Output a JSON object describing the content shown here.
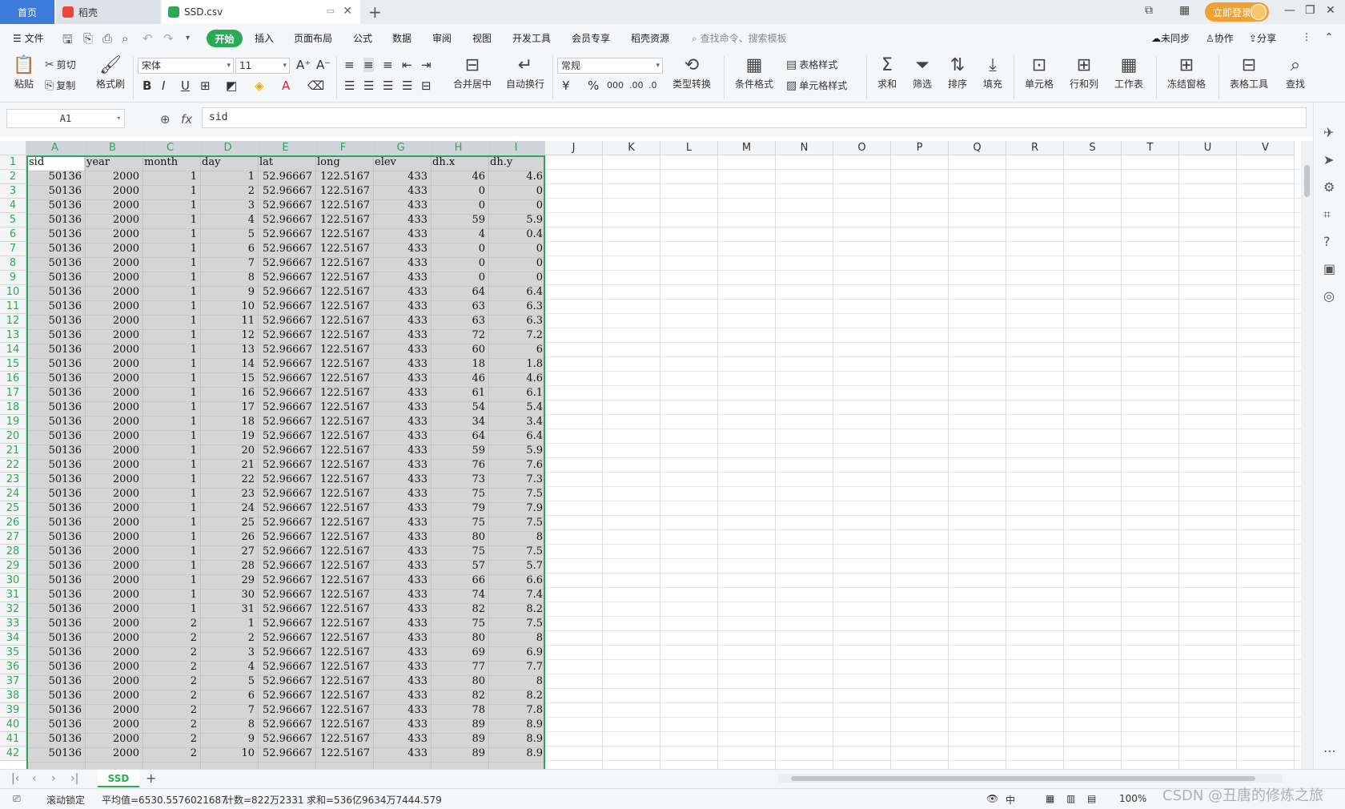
{
  "titlebar": {
    "home_tab": "首页",
    "doc_tab": "稻壳",
    "file_tab": "SSD.csv",
    "login_label": "立即登录"
  },
  "menu": {
    "file": "文件",
    "start": "开始",
    "items": [
      "插入",
      "页面布局",
      "公式",
      "数据",
      "审阅",
      "视图",
      "开发工具",
      "会员专享",
      "稻壳资源"
    ],
    "search_placeholder": "查找命令、搜索模板",
    "sync": "未同步",
    "collab": "协作",
    "share": "分享"
  },
  "ribbon": {
    "paste": "粘贴",
    "cut": "剪切",
    "copy": "复制",
    "format_painter": "格式刷",
    "font_name": "宋体",
    "font_size": "11",
    "merge_center": "合并居中",
    "wrap_text": "自动换行",
    "number_format": "常规",
    "type_convert": "类型转换",
    "conditional_format": "条件格式",
    "table_style": "表格样式",
    "cell_style": "单元格样式",
    "sum": "求和",
    "filter": "筛选",
    "sort": "排序",
    "fill": "填充",
    "cell": "单元格",
    "rows_cols": "行和列",
    "worksheet": "工作表",
    "freeze": "冻结窗格",
    "table_tools": "表格工具",
    "find": "查找"
  },
  "formula_bar": {
    "name_box": "A1",
    "fx": "fx",
    "content": "sid"
  },
  "columns": [
    "A",
    "B",
    "C",
    "D",
    "E",
    "F",
    "G",
    "H",
    "I",
    "J",
    "K",
    "L",
    "M",
    "N",
    "O",
    "P",
    "Q",
    "R",
    "S",
    "T",
    "U",
    "V"
  ],
  "header_row": [
    "sid",
    "year",
    "month",
    "day",
    "lat",
    "long",
    "elev",
    "dh.x",
    "dh.y"
  ],
  "rows": [
    [
      "50136",
      "2000",
      "1",
      "1",
      "52.96667",
      "122.5167",
      "433",
      "46",
      "4.6"
    ],
    [
      "50136",
      "2000",
      "1",
      "2",
      "52.96667",
      "122.5167",
      "433",
      "0",
      "0"
    ],
    [
      "50136",
      "2000",
      "1",
      "3",
      "52.96667",
      "122.5167",
      "433",
      "0",
      "0"
    ],
    [
      "50136",
      "2000",
      "1",
      "4",
      "52.96667",
      "122.5167",
      "433",
      "59",
      "5.9"
    ],
    [
      "50136",
      "2000",
      "1",
      "5",
      "52.96667",
      "122.5167",
      "433",
      "4",
      "0.4"
    ],
    [
      "50136",
      "2000",
      "1",
      "6",
      "52.96667",
      "122.5167",
      "433",
      "0",
      "0"
    ],
    [
      "50136",
      "2000",
      "1",
      "7",
      "52.96667",
      "122.5167",
      "433",
      "0",
      "0"
    ],
    [
      "50136",
      "2000",
      "1",
      "8",
      "52.96667",
      "122.5167",
      "433",
      "0",
      "0"
    ],
    [
      "50136",
      "2000",
      "1",
      "9",
      "52.96667",
      "122.5167",
      "433",
      "64",
      "6.4"
    ],
    [
      "50136",
      "2000",
      "1",
      "10",
      "52.96667",
      "122.5167",
      "433",
      "63",
      "6.3"
    ],
    [
      "50136",
      "2000",
      "1",
      "11",
      "52.96667",
      "122.5167",
      "433",
      "63",
      "6.3"
    ],
    [
      "50136",
      "2000",
      "1",
      "12",
      "52.96667",
      "122.5167",
      "433",
      "72",
      "7.2"
    ],
    [
      "50136",
      "2000",
      "1",
      "13",
      "52.96667",
      "122.5167",
      "433",
      "60",
      "6"
    ],
    [
      "50136",
      "2000",
      "1",
      "14",
      "52.96667",
      "122.5167",
      "433",
      "18",
      "1.8"
    ],
    [
      "50136",
      "2000",
      "1",
      "15",
      "52.96667",
      "122.5167",
      "433",
      "46",
      "4.6"
    ],
    [
      "50136",
      "2000",
      "1",
      "16",
      "52.96667",
      "122.5167",
      "433",
      "61",
      "6.1"
    ],
    [
      "50136",
      "2000",
      "1",
      "17",
      "52.96667",
      "122.5167",
      "433",
      "54",
      "5.4"
    ],
    [
      "50136",
      "2000",
      "1",
      "18",
      "52.96667",
      "122.5167",
      "433",
      "34",
      "3.4"
    ],
    [
      "50136",
      "2000",
      "1",
      "19",
      "52.96667",
      "122.5167",
      "433",
      "64",
      "6.4"
    ],
    [
      "50136",
      "2000",
      "1",
      "20",
      "52.96667",
      "122.5167",
      "433",
      "59",
      "5.9"
    ],
    [
      "50136",
      "2000",
      "1",
      "21",
      "52.96667",
      "122.5167",
      "433",
      "76",
      "7.6"
    ],
    [
      "50136",
      "2000",
      "1",
      "22",
      "52.96667",
      "122.5167",
      "433",
      "73",
      "7.3"
    ],
    [
      "50136",
      "2000",
      "1",
      "23",
      "52.96667",
      "122.5167",
      "433",
      "75",
      "7.5"
    ],
    [
      "50136",
      "2000",
      "1",
      "24",
      "52.96667",
      "122.5167",
      "433",
      "79",
      "7.9"
    ],
    [
      "50136",
      "2000",
      "1",
      "25",
      "52.96667",
      "122.5167",
      "433",
      "75",
      "7.5"
    ],
    [
      "50136",
      "2000",
      "1",
      "26",
      "52.96667",
      "122.5167",
      "433",
      "80",
      "8"
    ],
    [
      "50136",
      "2000",
      "1",
      "27",
      "52.96667",
      "122.5167",
      "433",
      "75",
      "7.5"
    ],
    [
      "50136",
      "2000",
      "1",
      "28",
      "52.96667",
      "122.5167",
      "433",
      "57",
      "5.7"
    ],
    [
      "50136",
      "2000",
      "1",
      "29",
      "52.96667",
      "122.5167",
      "433",
      "66",
      "6.6"
    ],
    [
      "50136",
      "2000",
      "1",
      "30",
      "52.96667",
      "122.5167",
      "433",
      "74",
      "7.4"
    ],
    [
      "50136",
      "2000",
      "1",
      "31",
      "52.96667",
      "122.5167",
      "433",
      "82",
      "8.2"
    ],
    [
      "50136",
      "2000",
      "2",
      "1",
      "52.96667",
      "122.5167",
      "433",
      "75",
      "7.5"
    ],
    [
      "50136",
      "2000",
      "2",
      "2",
      "52.96667",
      "122.5167",
      "433",
      "80",
      "8"
    ],
    [
      "50136",
      "2000",
      "2",
      "3",
      "52.96667",
      "122.5167",
      "433",
      "69",
      "6.9"
    ],
    [
      "50136",
      "2000",
      "2",
      "4",
      "52.96667",
      "122.5167",
      "433",
      "77",
      "7.7"
    ],
    [
      "50136",
      "2000",
      "2",
      "5",
      "52.96667",
      "122.5167",
      "433",
      "80",
      "8"
    ],
    [
      "50136",
      "2000",
      "2",
      "6",
      "52.96667",
      "122.5167",
      "433",
      "82",
      "8.2"
    ],
    [
      "50136",
      "2000",
      "2",
      "7",
      "52.96667",
      "122.5167",
      "433",
      "78",
      "7.8"
    ],
    [
      "50136",
      "2000",
      "2",
      "8",
      "52.96667",
      "122.5167",
      "433",
      "89",
      "8.9"
    ],
    [
      "50136",
      "2000",
      "2",
      "9",
      "52.96667",
      "122.5167",
      "433",
      "89",
      "8.9"
    ],
    [
      "50136",
      "2000",
      "2",
      "10",
      "52.96667",
      "122.5167",
      "433",
      "89",
      "8.9"
    ]
  ],
  "sheet": {
    "name": "SSD"
  },
  "status": {
    "scroll_lock": "滚动锁定",
    "average": "平均值=6530.5576021687",
    "count": "计数=822万2331",
    "sum": "求和=536亿9634万7444.579",
    "zoom": "100%"
  },
  "watermark": "CSDN @丑唐的修炼之旅",
  "colors": {
    "accent": "#2aaa56",
    "home_tab": "#3c7bd9",
    "login": "#f0a131"
  }
}
